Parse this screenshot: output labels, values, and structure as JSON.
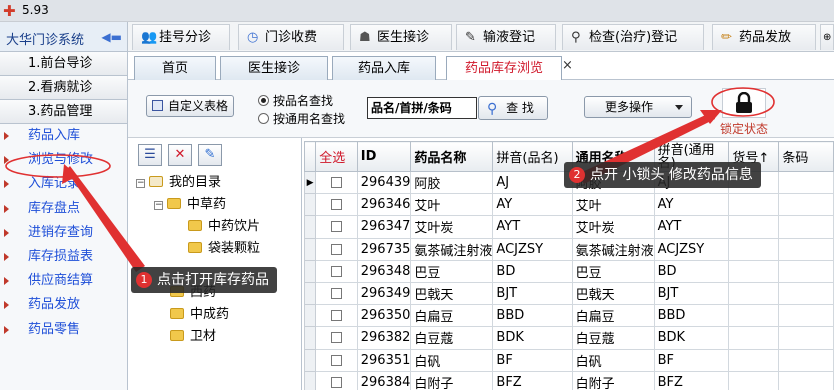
{
  "window": {
    "title": "5.93"
  },
  "sidebar": {
    "system_name": "大华门诊系统",
    "sections": [
      {
        "label": "1.前台导诊"
      },
      {
        "label": "2.看病就诊"
      },
      {
        "label": "3.药品管理"
      }
    ],
    "items": [
      {
        "label": "药品入库"
      },
      {
        "label": "浏览与修改"
      },
      {
        "label": "入库记录"
      },
      {
        "label": "库存盘点"
      },
      {
        "label": "进销存查询"
      },
      {
        "label": "库存损益表"
      },
      {
        "label": "供应商结算"
      },
      {
        "label": "药品发放"
      },
      {
        "label": "药品零售"
      }
    ]
  },
  "top_nav": {
    "tabs": [
      {
        "label": "挂号分诊",
        "icon": "users-icon"
      },
      {
        "label": "门诊收费",
        "icon": "clock-icon"
      },
      {
        "label": "医生接诊",
        "icon": "doctor-icon"
      },
      {
        "label": "输液登记",
        "icon": "syringe-icon"
      },
      {
        "label": "检查(治疗)登记",
        "icon": "walker-icon"
      },
      {
        "label": "药品发放",
        "icon": "pencil-icon"
      }
    ]
  },
  "doc_tabs": {
    "tabs": [
      {
        "label": "首页",
        "active": false
      },
      {
        "label": "医生接诊",
        "active": false
      },
      {
        "label": "药品入库",
        "active": false
      },
      {
        "label": "药品库存浏览",
        "active": true
      }
    ],
    "close_glyph": "×"
  },
  "toolbar": {
    "custom_table_label": "自定义表格",
    "radio_by_drug_name": "按品名查找",
    "radio_by_generic_name": "按通用名查找",
    "selected_radio": "by_drug_name",
    "search_value": "品名/首拼/条码",
    "search_button_label": "查 找",
    "more_ops_label": "更多操作",
    "lock_label": "锁定状态"
  },
  "tree": {
    "root": "我的目录",
    "nodes": [
      {
        "label": "中草药",
        "expanded": true
      },
      {
        "label": "中药饮片"
      },
      {
        "label": "袋装颗粒"
      },
      {
        "label": "西药"
      },
      {
        "label": "中成药"
      },
      {
        "label": "卫材"
      }
    ]
  },
  "grid": {
    "select_all_label": "全选",
    "columns": [
      "ID",
      "药品名称",
      "拼音(品名)",
      "通用名称",
      "拼音(通用名)",
      "货号↑",
      "条码"
    ],
    "rows": [
      {
        "id": "296439",
        "name": "阿胶",
        "pinyin": "AJ",
        "generic": "阿胶",
        "generic_pinyin": "AJ"
      },
      {
        "id": "296346",
        "name": "艾叶",
        "pinyin": "AY",
        "generic": "艾叶",
        "generic_pinyin": "AY"
      },
      {
        "id": "296347",
        "name": "艾叶炭",
        "pinyin": "AYT",
        "generic": "艾叶炭",
        "generic_pinyin": "AYT"
      },
      {
        "id": "296735",
        "name": "氨茶碱注射液",
        "pinyin": "ACJZSY",
        "generic": "氨茶碱注射液",
        "generic_pinyin": "ACJZSY"
      },
      {
        "id": "296348",
        "name": "巴豆",
        "pinyin": "BD",
        "generic": "巴豆",
        "generic_pinyin": "BD"
      },
      {
        "id": "296349",
        "name": "巴戟天",
        "pinyin": "BJT",
        "generic": "巴戟天",
        "generic_pinyin": "BJT"
      },
      {
        "id": "296350",
        "name": "白扁豆",
        "pinyin": "BBD",
        "generic": "白扁豆",
        "generic_pinyin": "BBD"
      },
      {
        "id": "296382",
        "name": "白豆蔻",
        "pinyin": "BDK",
        "generic": "白豆蔻",
        "generic_pinyin": "BDK"
      },
      {
        "id": "296351",
        "name": "白矾",
        "pinyin": "BF",
        "generic": "白矾",
        "generic_pinyin": "BF"
      },
      {
        "id": "296384",
        "name": "白附子",
        "pinyin": "BFZ",
        "generic": "白附子",
        "generic_pinyin": "BFZ"
      }
    ]
  },
  "annotations": {
    "callout_1": {
      "number": "1",
      "text": "点击打开库存药品"
    },
    "callout_2": {
      "number": "2",
      "text": "点开 小锁头 修改药品信息"
    },
    "highlight_color": "#e03131"
  }
}
